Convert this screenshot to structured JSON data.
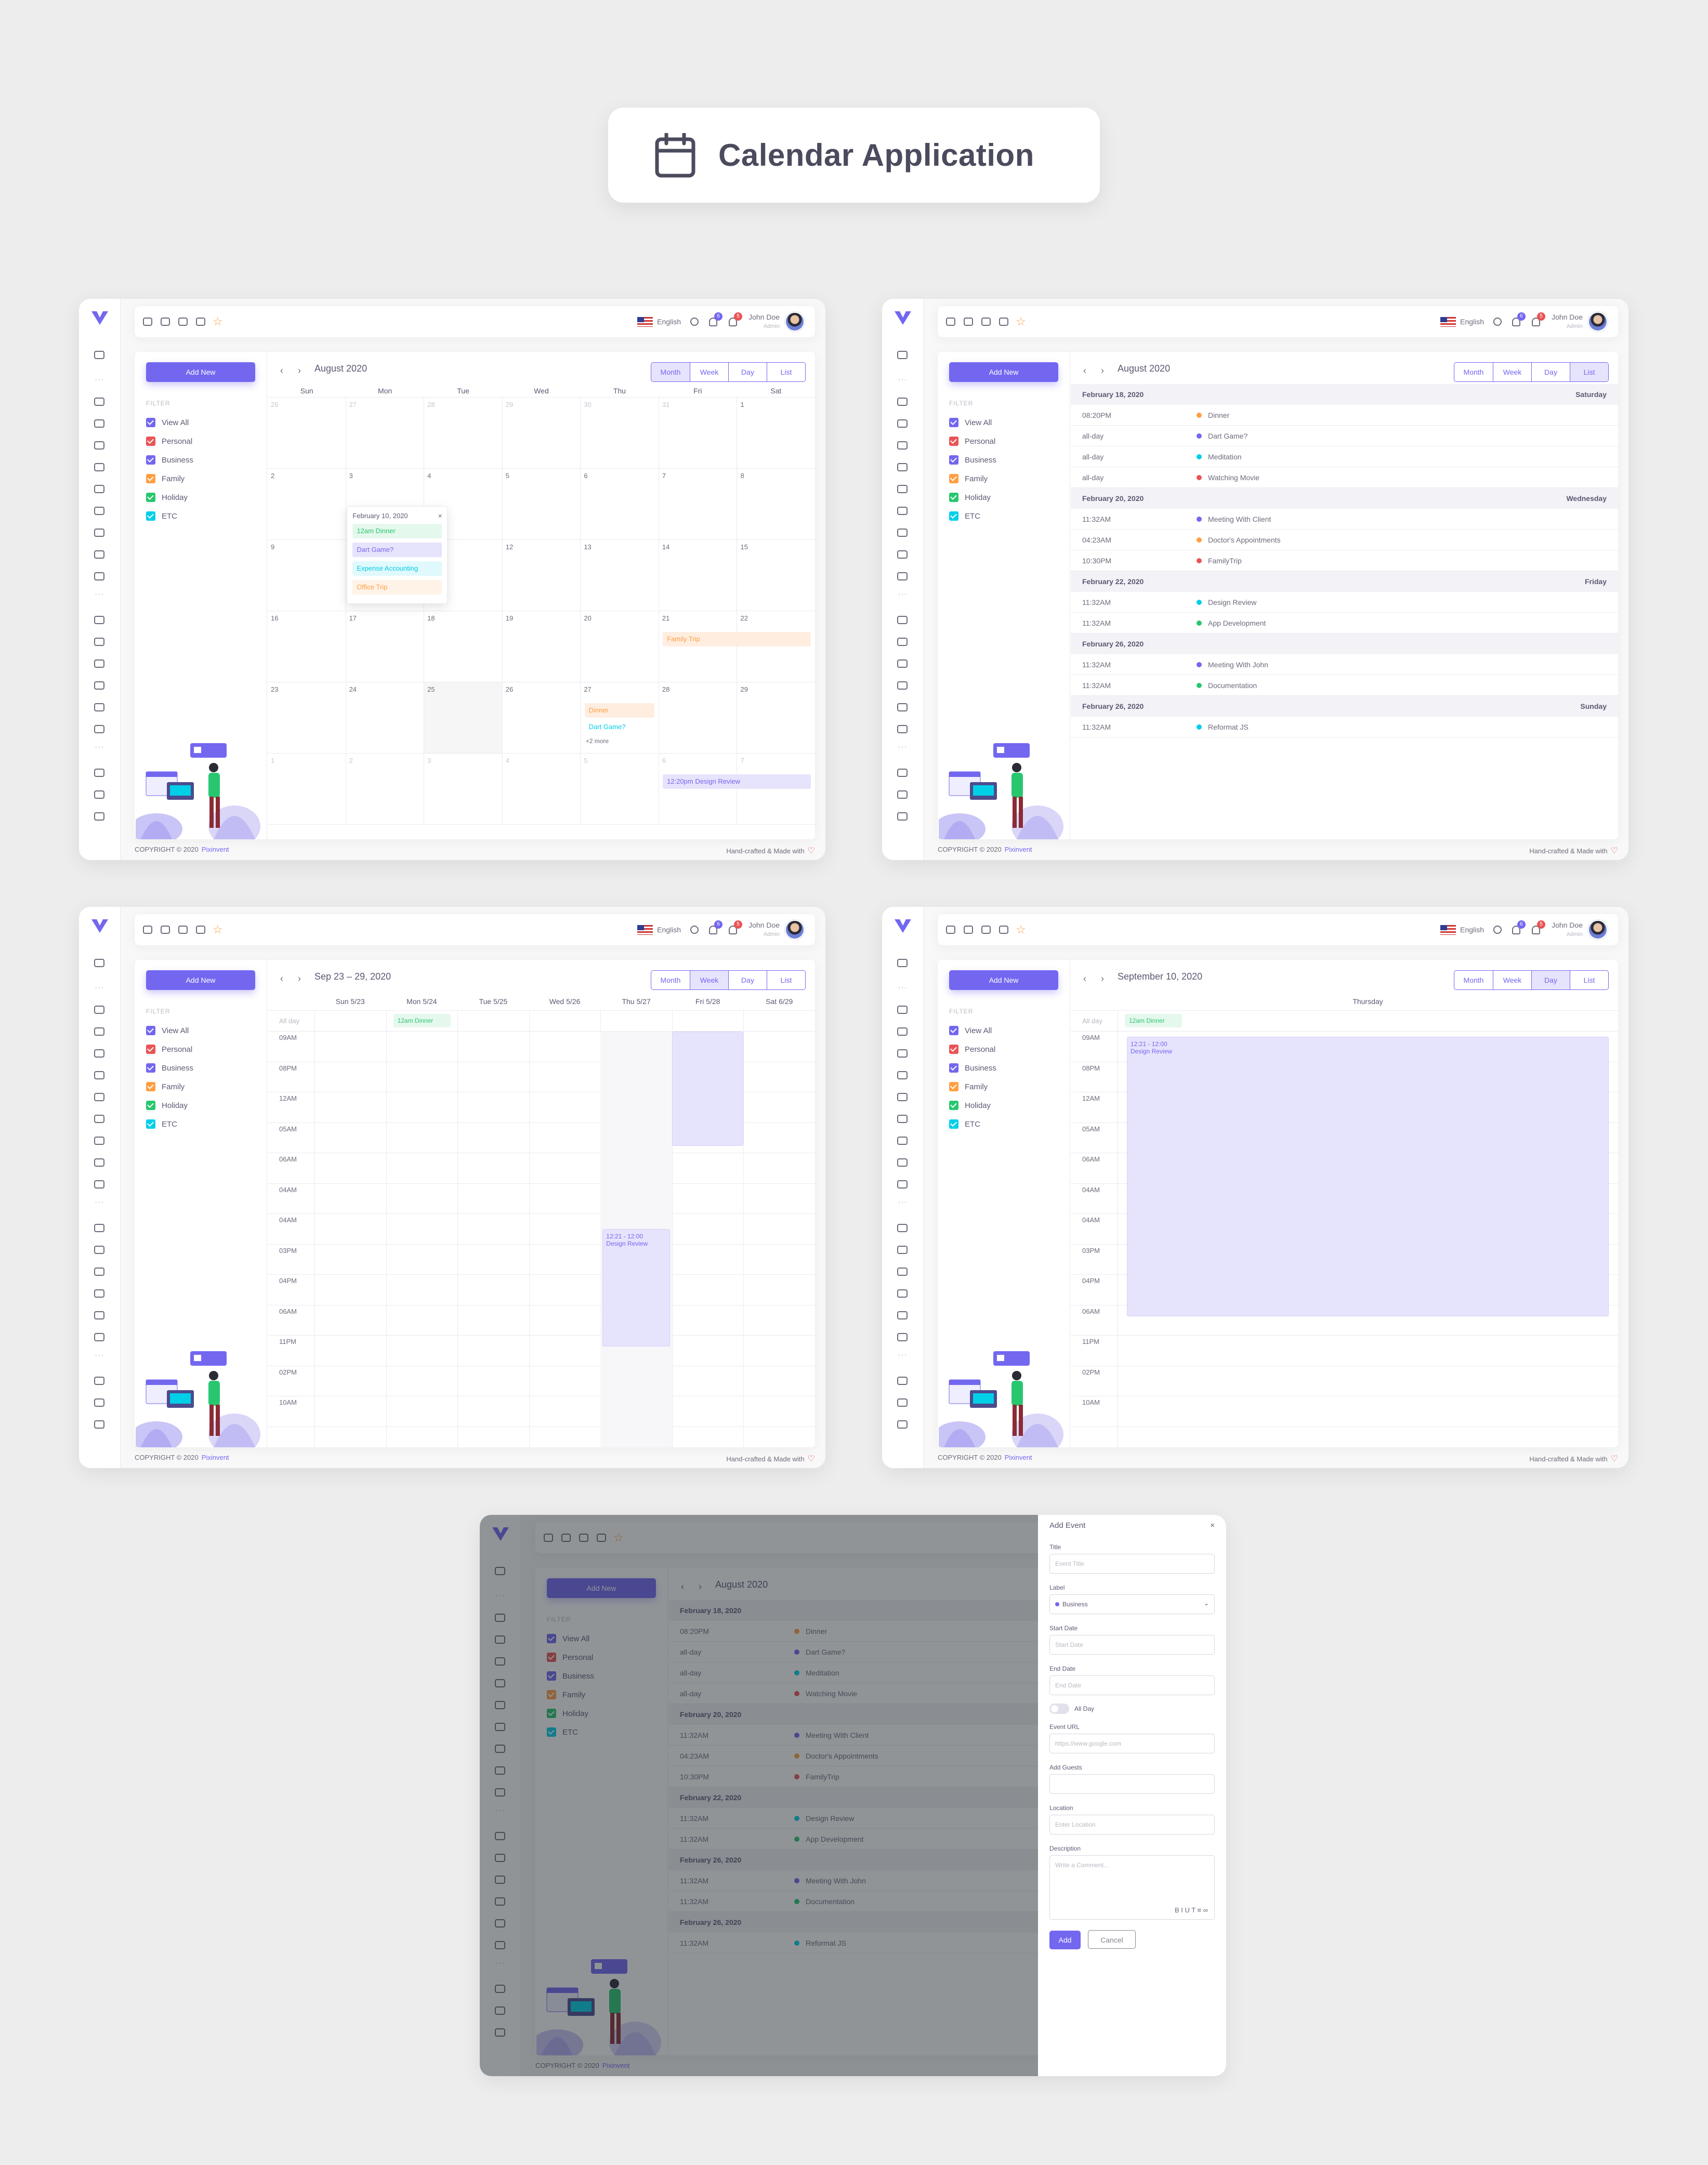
{
  "heading": {
    "title": "Calendar Application",
    "icon": "calendar-icon"
  },
  "colors": {
    "primary": "#7367f0",
    "danger": "#ea5455",
    "warning": "#ff9f43",
    "success": "#28c76f",
    "info": "#00cfe8"
  },
  "topbar": {
    "language": "English",
    "user_name": "John Doe",
    "user_role": "Admin",
    "cart_count": "6",
    "notif_count": "5"
  },
  "sidebar": {
    "add_new": "Add New",
    "filter_title": "FILTER",
    "filters": [
      {
        "label": "View All",
        "color": "#7367f0"
      },
      {
        "label": "Personal",
        "color": "#ea5455"
      },
      {
        "label": "Business",
        "color": "#7367f0"
      },
      {
        "label": "Family",
        "color": "#ff9f43"
      },
      {
        "label": "Holiday",
        "color": "#28c76f"
      },
      {
        "label": "ETC",
        "color": "#00cfe8"
      }
    ]
  },
  "views": [
    "Month",
    "Week",
    "Day",
    "List"
  ],
  "footer": {
    "copyright": "COPYRIGHT © 2020",
    "brand": "Pixinvent",
    "made": "Hand-crafted & Made with"
  },
  "month_view": {
    "title": "August 2020",
    "weekdays": [
      "Sun",
      "Mon",
      "Tue",
      "Wed",
      "Thu",
      "Fri",
      "Sat"
    ],
    "weeks": [
      [
        "26",
        "27",
        "28",
        "29",
        "30",
        "31",
        "1"
      ],
      [
        "2",
        "3",
        "4",
        "5",
        "6",
        "7",
        "8"
      ],
      [
        "9",
        "10",
        "11",
        "12",
        "13",
        "14",
        "15"
      ],
      [
        "16",
        "17",
        "18",
        "19",
        "20",
        "21",
        "22"
      ],
      [
        "23",
        "24",
        "25",
        "26",
        "27",
        "28",
        "29"
      ],
      [
        "1",
        "2",
        "3",
        "4",
        "5",
        "6",
        "7"
      ]
    ],
    "events": {
      "family_trip": "Family Trip",
      "dinner": "Dinner",
      "dart_game": "Dart Game?",
      "more": "+2 more",
      "design_review": "12:20pm Design Review"
    },
    "popup": {
      "date": "February 10, 2020",
      "close": "×",
      "items": [
        "12am Dinner",
        "Dart Game?",
        "Expense Accounting",
        "Office Trip"
      ]
    }
  },
  "list_view": {
    "title": "August 2020",
    "groups": [
      {
        "date": "February 18, 2020",
        "day": "Saturday",
        "items": [
          {
            "time": "08:20PM",
            "name": "Dinner",
            "color": "#ff9f43"
          },
          {
            "time": "all-day",
            "name": "Dart Game?",
            "color": "#7367f0"
          },
          {
            "time": "all-day",
            "name": "Meditation",
            "color": "#00cfe8"
          },
          {
            "time": "all-day",
            "name": "Watching Movie",
            "color": "#ea5455"
          }
        ]
      },
      {
        "date": "February 20, 2020",
        "day": "Wednesday",
        "items": [
          {
            "time": "11:32AM",
            "name": "Meeting With Client",
            "color": "#7367f0"
          },
          {
            "time": "04:23AM",
            "name": "Doctor's Appointments",
            "color": "#ff9f43"
          },
          {
            "time": "10:30PM",
            "name": "FamilyTrip",
            "color": "#ea5455"
          }
        ]
      },
      {
        "date": "February 22, 2020",
        "day": "Friday",
        "items": [
          {
            "time": "11:32AM",
            "name": "Design Review",
            "color": "#00cfe8"
          },
          {
            "time": "11:32AM",
            "name": "App Development",
            "color": "#28c76f"
          }
        ]
      },
      {
        "date": "February 26, 2020",
        "day": "",
        "items": [
          {
            "time": "11:32AM",
            "name": "Meeting With John",
            "color": "#7367f0"
          },
          {
            "time": "11:32AM",
            "name": "Documentation",
            "color": "#28c76f"
          }
        ]
      },
      {
        "date": "February 26, 2020",
        "day": "Sunday",
        "items": [
          {
            "time": "11:32AM",
            "name": "Reformat JS",
            "color": "#00cfe8"
          }
        ]
      }
    ]
  },
  "week_view": {
    "title": "Sep 23 – 29, 2020",
    "days": [
      "Sun 5/23",
      "Mon 5/24",
      "Tue 5/25",
      "Wed 5/26",
      "Thu 5/27",
      "Fri 5/28",
      "Sat 6/29"
    ],
    "allday_label": "All day",
    "allday_event": "12am Dinner",
    "slots": [
      "09AM",
      "08PM",
      "12AM",
      "05AM",
      "06AM",
      "04AM",
      "04AM",
      "03PM",
      "04PM",
      "06AM",
      "11PM",
      "02PM",
      "10AM"
    ],
    "block_time": "12:21 - 12:00",
    "block_name": "Design Review"
  },
  "day_view": {
    "title": "September 10, 2020",
    "weekday": "Thursday",
    "allday_label": "All day",
    "allday_event": "12am Dinner",
    "slots": [
      "09AM",
      "08PM",
      "12AM",
      "05AM",
      "06AM",
      "04AM",
      "04AM",
      "03PM",
      "04PM",
      "06AM",
      "11PM",
      "02PM",
      "10AM"
    ],
    "block_time": "12:21 - 12:00",
    "block_name": "Design Review"
  },
  "add_event": {
    "title": "Add Event",
    "close": "×",
    "fields": [
      {
        "label": "Title",
        "placeholder": "Event Title"
      },
      {
        "label": "Label",
        "value": "Business"
      },
      {
        "label": "Start Date",
        "placeholder": "Start Date"
      },
      {
        "label": "End Date",
        "placeholder": "End Date"
      },
      {
        "label": "Event URL",
        "placeholder": "https://www.google.com"
      },
      {
        "label": "Add Guests",
        "placeholder": ""
      },
      {
        "label": "Location",
        "placeholder": "Enter Location"
      },
      {
        "label": "Description",
        "placeholder": "Write a Comment..."
      }
    ],
    "allday": "All Day",
    "add": "Add",
    "cancel": "Cancel"
  }
}
